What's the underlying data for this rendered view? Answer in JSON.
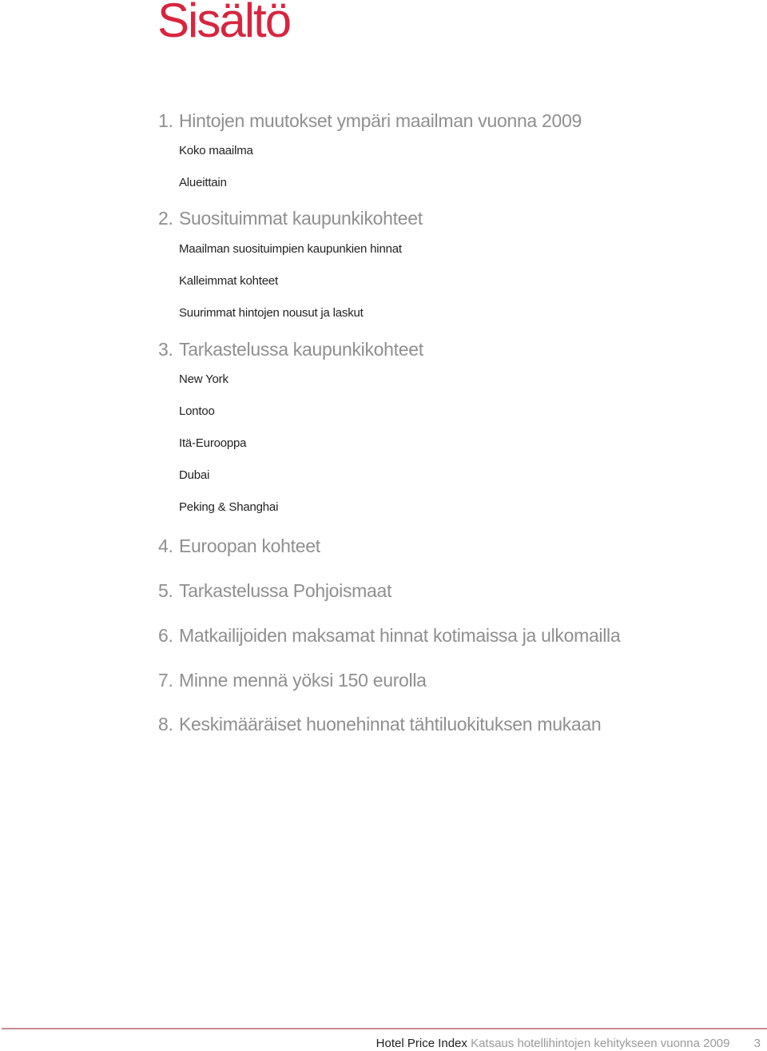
{
  "title": "Sisältö",
  "sections": [
    {
      "num": "1.",
      "label": "Hintojen muutokset ympäri maailman vuonna 2009",
      "items": [
        "Koko maailma",
        "Alueittain"
      ]
    },
    {
      "num": "2.",
      "label": "Suosituimmat kaupunkikohteet",
      "items": [
        "Maailman suosituimpien kaupunkien hinnat",
        "Kalleimmat kohteet",
        "Suurimmat hintojen nousut ja laskut"
      ]
    },
    {
      "num": "3.",
      "label": "Tarkastelussa kaupunkikohteet",
      "items": [
        "New York",
        "Lontoo",
        "Itä-Eurooppa",
        "Dubai",
        "Peking & Shanghai"
      ]
    },
    {
      "num": "4.",
      "label": "Euroopan kohteet",
      "items": []
    },
    {
      "num": "5.",
      "label": "Tarkastelussa Pohjoismaat",
      "items": []
    },
    {
      "num": "6.",
      "label": "Matkailijoiden maksamat hinnat kotimaissa ja ulkomailla",
      "items": []
    },
    {
      "num": "7.",
      "label": "Minne mennä yöksi 150 eurolla",
      "items": []
    },
    {
      "num": "8.",
      "label": "Keskimääräiset huonehinnat tähtiluokituksen mukaan",
      "items": []
    }
  ],
  "footer": {
    "brand": "Hotel Price Index",
    "subtitle": "Katsaus hotellihintojen kehitykseen vuonna 2009",
    "page": "3"
  }
}
